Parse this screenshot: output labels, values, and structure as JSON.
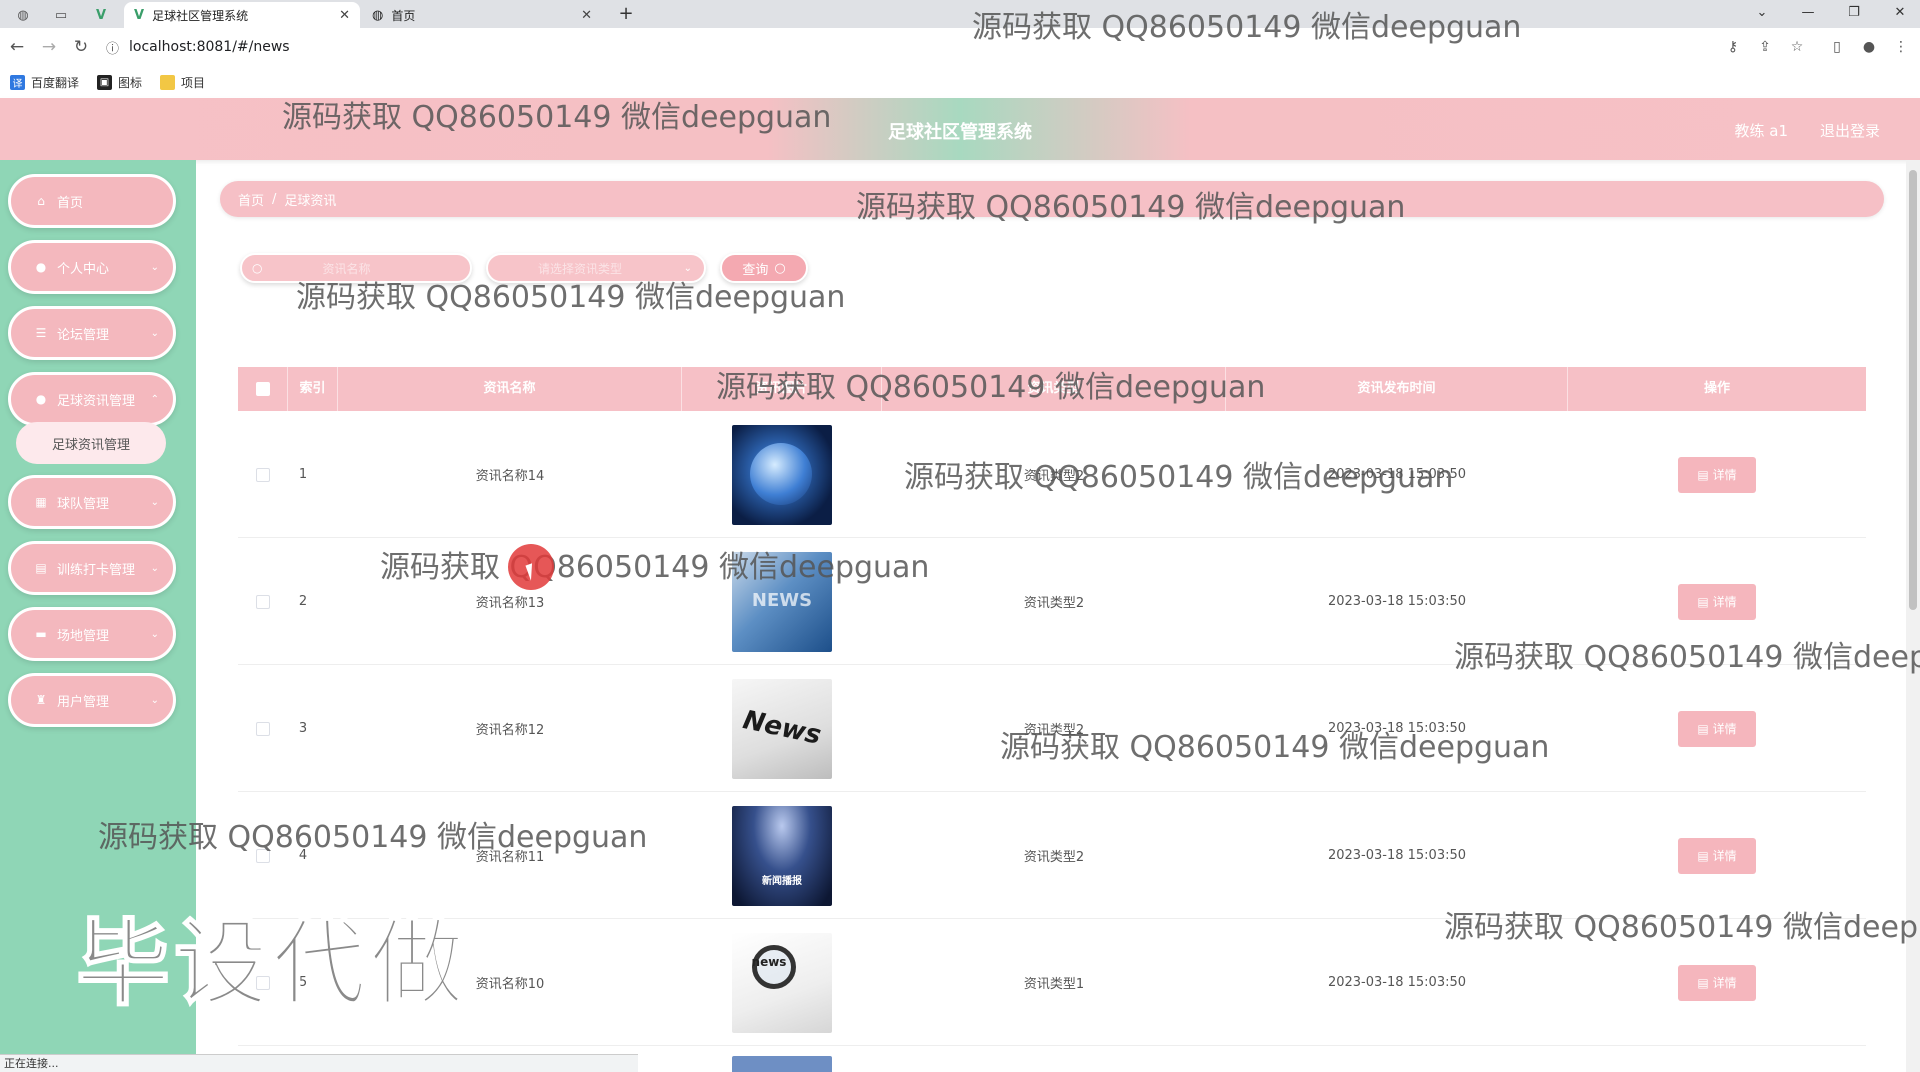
{
  "browser": {
    "tabs": [
      {
        "title": "足球社区管理系统",
        "active": true
      },
      {
        "title": "首页",
        "active": false
      }
    ],
    "url": "localhost:8081/#/news",
    "bookmarks": [
      "百度翻译",
      "图标",
      "项目"
    ],
    "status_text": "正在连接..."
  },
  "header": {
    "title": "足球社区管理系统",
    "user": "教练 a1",
    "logout": "退出登录",
    "colors": {
      "pink": "#f6c1c6",
      "mint": "#8fd6b6"
    }
  },
  "sidebar": {
    "items": [
      {
        "label": "首页",
        "icon": "home-icon"
      },
      {
        "label": "个人中心",
        "icon": "user-icon"
      },
      {
        "label": "论坛管理",
        "icon": "list-icon"
      },
      {
        "label": "足球资讯管理",
        "icon": "user-icon",
        "expanded": true
      },
      {
        "label": "球队管理",
        "icon": "grid-icon"
      },
      {
        "label": "训练打卡管理",
        "icon": "calendar-icon"
      },
      {
        "label": "场地管理",
        "icon": "monitor-icon"
      },
      {
        "label": "用户管理",
        "icon": "trophy-icon"
      }
    ],
    "submenu": {
      "label": "足球资讯管理"
    }
  },
  "breadcrumb": {
    "home": "首页",
    "current": "足球资讯"
  },
  "search": {
    "name_placeholder": "资讯名称",
    "type_placeholder": "请选择资讯类型",
    "query_label": "查询"
  },
  "table": {
    "headers": [
      "索引",
      "资讯名称",
      "资讯图片",
      "资讯类型",
      "资讯发布时间",
      "操作"
    ],
    "detail_label": "详情",
    "rows": [
      {
        "index": "1",
        "name": "资讯名称14",
        "type": "资讯类型2",
        "time": "2023-03-18 15:03:50",
        "thumb_label": ""
      },
      {
        "index": "2",
        "name": "资讯名称13",
        "type": "资讯类型2",
        "time": "2023-03-18 15:03:50",
        "thumb_label": "NEWS"
      },
      {
        "index": "3",
        "name": "资讯名称12",
        "type": "资讯类型2",
        "time": "2023-03-18 15:03:50",
        "thumb_label": "News"
      },
      {
        "index": "4",
        "name": "资讯名称11",
        "type": "资讯类型2",
        "time": "2023-03-18 15:03:50",
        "thumb_label": "新闻播报"
      },
      {
        "index": "5",
        "name": "资讯名称10",
        "type": "资讯类型1",
        "time": "2023-03-18 15:03:50",
        "thumb_label": "news"
      }
    ]
  },
  "watermarks": {
    "text": "源码获取 QQ86050149 微信deepguan",
    "text_cut": "源码获取 QQ86050149 微信deep",
    "big": "毕设代做"
  }
}
